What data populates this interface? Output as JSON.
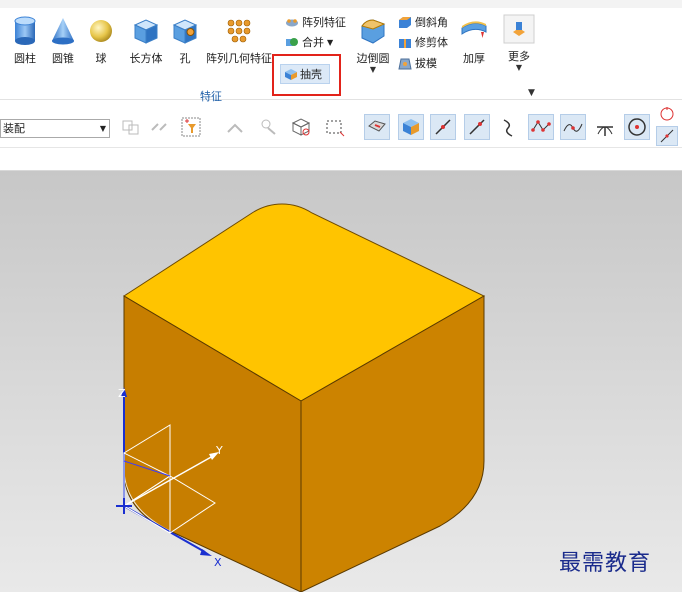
{
  "ribbon": {
    "buttons": [
      {
        "label": "圆柱"
      },
      {
        "label": "圆锥"
      },
      {
        "label": "球"
      },
      {
        "label": "长方体"
      },
      {
        "label": "孔"
      },
      {
        "label": "阵列几何特征"
      },
      {
        "label": "边倒圆"
      },
      {
        "label": "加厚"
      },
      {
        "label": "更多"
      }
    ],
    "small_items": {
      "pattern_feature": "阵列特征",
      "combine": "合并",
      "shell": "抽壳",
      "chamfer": "倒斜角",
      "trim_body": "修剪体",
      "draft": "拔模"
    },
    "group_label": "特征"
  },
  "toolbar": {
    "filter_value": "装配"
  },
  "viewport": {
    "axis_labels": {
      "x": "X",
      "y": "Y",
      "z": "Z"
    },
    "watermark": "最需教育",
    "colors": {
      "top_face": "#FFC400",
      "left_face": "#C77E00",
      "right_face": "#CC8300"
    }
  }
}
